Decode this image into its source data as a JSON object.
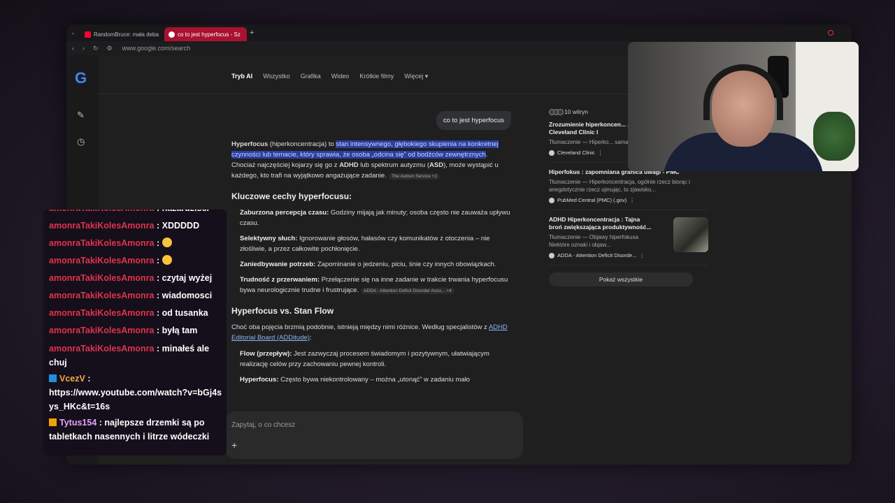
{
  "browser": {
    "tabs": [
      {
        "label": "RandomBruce: mała debat"
      },
      {
        "label": "co to jest hyperfocus - Sz"
      }
    ],
    "url": "www.google.com/search"
  },
  "google": {
    "logo": "G",
    "nav_tabs": [
      "Tryb AI",
      "Wszystko",
      "Grafika",
      "Wideo",
      "Krótkie filmy",
      "Więcej"
    ],
    "query": "co to jest hyperfocus",
    "answer": {
      "intro_term": "Hyperfocus",
      "intro_paren": " (hiperkoncentracja) to ",
      "intro_highlight": "stan intensywnego, głębokiego skupienia na konkretnej czynności lub temacie, który sprawia, że osoba „odcina się” od bodźców zewnętrznych",
      "intro_rest_1": ". Chociaż najczęściej kojarzy się go z ",
      "intro_adhd": "ADHD",
      "intro_rest_2": " lub spektrum autyzmu (",
      "intro_asd": "ASD",
      "intro_rest_3": "), może wystąpić u każdego, kto trafi na wyjątkowo angażujące zadanie.",
      "intro_source": "The Autism Service +2",
      "section1_title": "Kluczowe cechy hyperfocusu:",
      "bullets1": [
        {
          "term": "Zaburzona percepcja czasu:",
          "text": " Godziny mijają jak minuty; osoba często nie zauważa upływu czasu."
        },
        {
          "term": "Selektywny słuch:",
          "text": " Ignorowanie głosów, hałasów czy komunikatów z otoczenia – nie złośliwie, a przez całkowite pochłonięcie."
        },
        {
          "term": "Zaniedbywanie potrzeb:",
          "text": " Zapominanie o jedzeniu, piciu, śnie czy innych obowiązkach."
        },
        {
          "term": "Trudność z przerwaniem:",
          "text": " Przełączenie się na inne zadanie w trakcie trwania hyperfocusu bywa neurologicznie trudne i frustrujące."
        }
      ],
      "bullet_source": "ADDA - Attention Deficit Disorder Asso... +4",
      "section2_title": "Hyperfocus vs. Stan Flow",
      "section2_intro": "Choć oba pojęcia brzmią podobnie, istnieją między nimi różnice. Według specjalistów z ",
      "section2_link": "ADHD Editorial Board (ADDitude)",
      "section2_colon": ":",
      "bullets2": [
        {
          "term": "Flow (przepływ):",
          "text": " Jest zazwyczaj procesem świadomym i pozytywnym, ułatwiającym realizację celów przy zachowaniu pewnej kontroli."
        },
        {
          "term": "Hyperfocus:",
          "text": " Często bywa niekontrolowany – można „utonąć” w zadaniu mało"
        }
      ]
    },
    "ask_placeholder": "Zapytaj, o co chcesz",
    "sources_head": "10 witryn",
    "source_cards": [
      {
        "title": "Zrozumienie hiperkoncen... ADHD – Cleveland Clinic l",
        "snippet": "Tłumaczenie — Hiperko... sama w sobie nie jest zła -",
        "site": "Cleveland Clinic"
      },
      {
        "title": "Hiperfokus : zapomniana granica uwagi - PMC",
        "snippet": "Tłumaczenie — Hiperkoncentracja, ogólnie rzecz biorąc i anegdotycznie rzecz ujmując, to zjawisko...",
        "site": "PubMed Central (PMC) (.gov)"
      },
      {
        "title": "ADHD Hiperkoncentracja : Tajna broń zwiększająca produktywność...",
        "snippet": "Tłumaczenie — Objawy hiperfokusa Niektóre oznaki i objaw...",
        "site": "ADDA - Attention Deficit Disorde..."
      }
    ],
    "show_all": "Pokaż wszystkie"
  },
  "chat": {
    "messages": [
      {
        "user": "amonraTakiKolesAmonra",
        "sep": " : ",
        "text": "nazardzisci"
      },
      {
        "user": "amonraTakiKolesAmonra",
        "sep": " : ",
        "text": "XDDDDD"
      },
      {
        "user": "amonraTakiKolesAmonra",
        "sep": " : ",
        "text": ""
      },
      {
        "user": "amonraTakiKolesAmonra",
        "sep": " : ",
        "text": ""
      },
      {
        "user": "amonraTakiKolesAmonra",
        "sep": " : ",
        "text": "czytaj wyżej"
      },
      {
        "user": "amonraTakiKolesAmonra",
        "sep": " : ",
        "text": "wiadomosci"
      },
      {
        "user": "amonraTakiKolesAmonra",
        "sep": " : ",
        "text": "od tusanka"
      },
      {
        "user": "amonraTakiKolesAmonra",
        "sep": " : ",
        "text": "byłą tam"
      },
      {
        "user": "amonraTakiKolesAmonra",
        "sep": " : ",
        "text": "minałeś ale chuj"
      },
      {
        "user": "VcezV",
        "sep": " :",
        "text": "https://www.youtube.com/watch?v=bGj4sys_HKc&t=16s"
      },
      {
        "user": "Tytus154",
        "sep": " : ",
        "text": "najlepsze drzemki są po tabletkach nasennych i litrze wódeczki"
      }
    ],
    "colors": {
      "amonra": "#e0334e",
      "vcezv": "#f4a742",
      "tytus": "#e8a0ff"
    }
  }
}
